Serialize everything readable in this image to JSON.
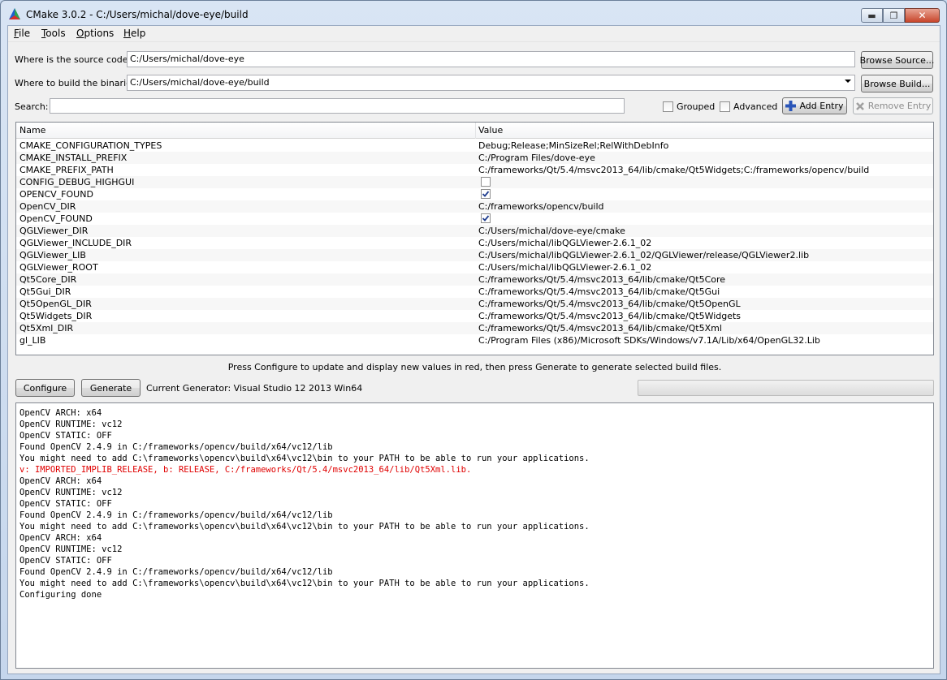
{
  "window": {
    "title": "CMake 3.0.2 - C:/Users/michal/dove-eye/build",
    "controls": {
      "minimize": "▬",
      "maximize": "❐",
      "close": "✕"
    }
  },
  "menu": [
    {
      "label": "File",
      "mnemonic": "F",
      "rest": "ile"
    },
    {
      "label": "Tools",
      "mnemonic": "T",
      "rest": "ools"
    },
    {
      "label": "Options",
      "mnemonic": "O",
      "rest": "ptions"
    },
    {
      "label": "Help",
      "mnemonic": "H",
      "rest": "elp"
    }
  ],
  "source": {
    "label": "Where is the source code:",
    "value": "C:/Users/michal/dove-eye",
    "browse_label": "Browse Source..."
  },
  "build": {
    "label": "Where to build the binaries:",
    "value": "C:/Users/michal/dove-eye/build",
    "browse_label": "Browse Build..."
  },
  "search": {
    "label": "Search:",
    "value": ""
  },
  "options": {
    "grouped_label": "Grouped",
    "grouped_checked": false,
    "advanced_label": "Advanced",
    "advanced_checked": false,
    "add_entry_label": "Add Entry",
    "remove_entry_label": "Remove Entry"
  },
  "table": {
    "headers": {
      "name": "Name",
      "value": "Value"
    },
    "rows": [
      {
        "name": "CMAKE_CONFIGURATION_TYPES",
        "value": "Debug;Release;MinSizeRel;RelWithDebInfo"
      },
      {
        "name": "CMAKE_INSTALL_PREFIX",
        "value": "C:/Program Files/dove-eye"
      },
      {
        "name": "CMAKE_PREFIX_PATH",
        "value": "C:/frameworks/Qt/5.4/msvc2013_64/lib/cmake/Qt5Widgets;C:/frameworks/opencv/build"
      },
      {
        "name": "CONFIG_DEBUG_HIGHGUI",
        "checkbox": true,
        "checked": false
      },
      {
        "name": "OPENCV_FOUND",
        "checkbox": true,
        "checked": true
      },
      {
        "name": "OpenCV_DIR",
        "value": "C:/frameworks/opencv/build"
      },
      {
        "name": "OpenCV_FOUND",
        "checkbox": true,
        "checked": true
      },
      {
        "name": "QGLViewer_DIR",
        "value": "C:/Users/michal/dove-eye/cmake"
      },
      {
        "name": "QGLViewer_INCLUDE_DIR",
        "value": "C:/Users/michal/libQGLViewer-2.6.1_02"
      },
      {
        "name": "QGLViewer_LIB",
        "value": "C:/Users/michal/libQGLViewer-2.6.1_02/QGLViewer/release/QGLViewer2.lib"
      },
      {
        "name": "QGLViewer_ROOT",
        "value": "C:/Users/michal/libQGLViewer-2.6.1_02"
      },
      {
        "name": "Qt5Core_DIR",
        "value": "C:/frameworks/Qt/5.4/msvc2013_64/lib/cmake/Qt5Core"
      },
      {
        "name": "Qt5Gui_DIR",
        "value": "C:/frameworks/Qt/5.4/msvc2013_64/lib/cmake/Qt5Gui"
      },
      {
        "name": "Qt5OpenGL_DIR",
        "value": "C:/frameworks/Qt/5.4/msvc2013_64/lib/cmake/Qt5OpenGL"
      },
      {
        "name": "Qt5Widgets_DIR",
        "value": "C:/frameworks/Qt/5.4/msvc2013_64/lib/cmake/Qt5Widgets"
      },
      {
        "name": "Qt5Xml_DIR",
        "value": "C:/frameworks/Qt/5.4/msvc2013_64/lib/cmake/Qt5Xml"
      },
      {
        "name": "gl_LIB",
        "value": "C:/Program Files (x86)/Microsoft SDKs/Windows/v7.1A/Lib/x64/OpenGL32.Lib"
      }
    ]
  },
  "hint": "Press Configure to update and display new values in red, then press Generate to generate selected build files.",
  "actions": {
    "configure_label": "Configure",
    "generate_label": "Generate",
    "generator_text": "Current Generator: Visual Studio 12 2013 Win64",
    "progress": 0
  },
  "output": [
    {
      "text": "OpenCV ARCH: x64"
    },
    {
      "text": "OpenCV RUNTIME: vc12"
    },
    {
      "text": "OpenCV STATIC: OFF"
    },
    {
      "text": "Found OpenCV 2.4.9 in C:/frameworks/opencv/build/x64/vc12/lib"
    },
    {
      "text": "You might need to add C:\\frameworks\\opencv\\build\\x64\\vc12\\bin to your PATH to be able to run your applications."
    },
    {
      "text": "v: IMPORTED_IMPLIB_RELEASE, b: RELEASE, C:/frameworks/Qt/5.4/msvc2013_64/lib/Qt5Xml.lib.",
      "error": true
    },
    {
      "text": "OpenCV ARCH: x64"
    },
    {
      "text": "OpenCV RUNTIME: vc12"
    },
    {
      "text": "OpenCV STATIC: OFF"
    },
    {
      "text": "Found OpenCV 2.4.9 in C:/frameworks/opencv/build/x64/vc12/lib"
    },
    {
      "text": "You might need to add C:\\frameworks\\opencv\\build\\x64\\vc12\\bin to your PATH to be able to run your applications."
    },
    {
      "text": "OpenCV ARCH: x64"
    },
    {
      "text": "OpenCV RUNTIME: vc12"
    },
    {
      "text": "OpenCV STATIC: OFF"
    },
    {
      "text": "Found OpenCV 2.4.9 in C:/frameworks/opencv/build/x64/vc12/lib"
    },
    {
      "text": "You might need to add C:\\frameworks\\opencv\\build\\x64\\vc12\\bin to your PATH to be able to run your applications."
    },
    {
      "text": "Configuring done"
    }
  ],
  "colors": {
    "error_text": "#e00000",
    "accent": "#1f3d8f"
  }
}
